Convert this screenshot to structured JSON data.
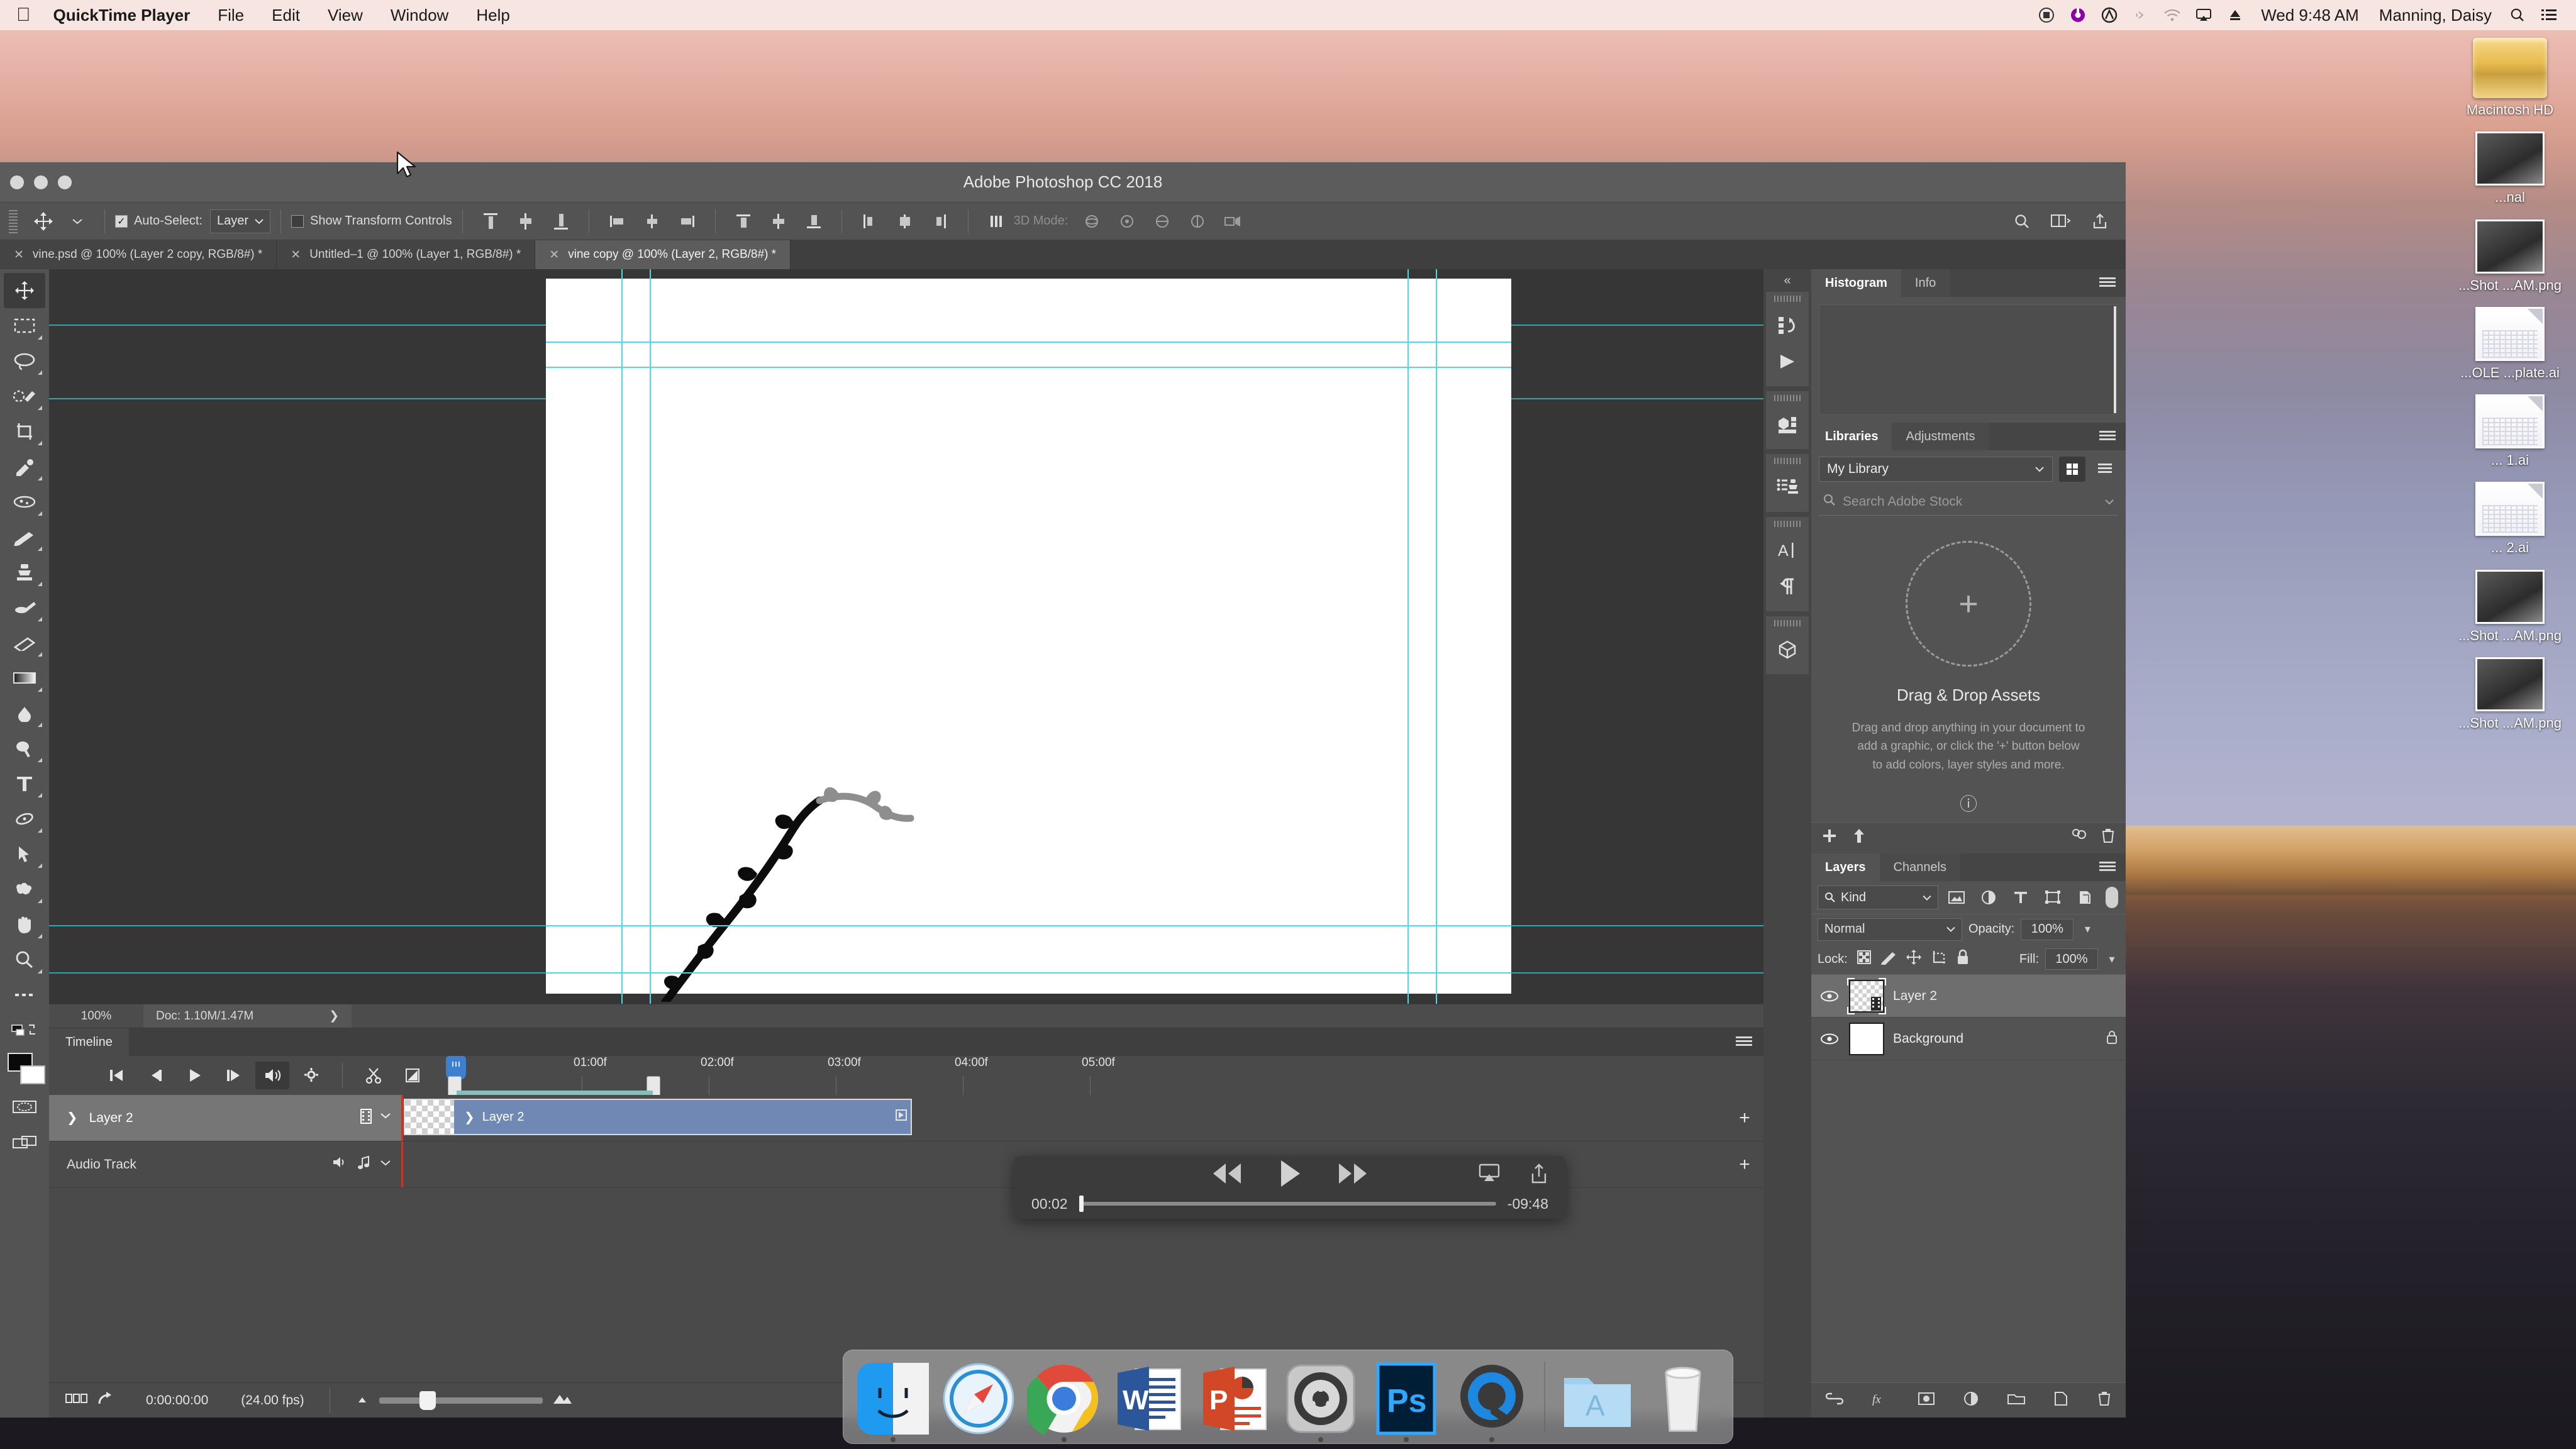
{
  "menubar": {
    "apple_icon": "apple-logo",
    "app_name": "QuickTime Player",
    "items": [
      "File",
      "Edit",
      "View",
      "Window",
      "Help"
    ],
    "status_icons": [
      "record-icon",
      "creative-cloud-icon",
      "adobe-icon",
      "bluetooth-icon",
      "wifi-icon",
      "airplay-icon",
      "eject-icon"
    ],
    "clock": "Wed 9:48 AM",
    "user": "Manning, Daisy",
    "search_icon": "search-icon",
    "control_center_icon": "list-icon"
  },
  "desktop": {
    "files": [
      {
        "label": "Macintosh HD",
        "kind": "hard-drive"
      },
      {
        "label": "...nal",
        "kind": "photo"
      },
      {
        "label": "...Shot\n...AM.png",
        "kind": "photo"
      },
      {
        "label": "...OLE\n...plate.ai",
        "kind": "ai"
      },
      {
        "label": "... 1.ai",
        "kind": "ai"
      },
      {
        "label": "... 2.ai",
        "kind": "ai"
      },
      {
        "label": "...Shot\n...AM.png",
        "kind": "photo"
      },
      {
        "label": "...Shot\n...AM.png",
        "kind": "photo"
      }
    ]
  },
  "photoshop": {
    "window_title": "Adobe Photoshop CC 2018",
    "options_bar": {
      "move_tool_icon": "move-tool-icon",
      "auto_select_label": "Auto-Select:",
      "auto_select_checked": true,
      "auto_select_value": "Layer",
      "show_transform_label": "Show Transform Controls",
      "show_transform_checked": false,
      "align_icons": [
        "align-top-edges-icon",
        "align-vertical-centers-icon",
        "align-bottom-edges-icon",
        "align-left-edges-icon",
        "align-horizontal-centers-icon",
        "align-right-edges-icon",
        "distribute-top-icon",
        "distribute-vertical-center-icon",
        "distribute-bottom-icon",
        "distribute-left-icon",
        "distribute-horizontal-center-icon",
        "distribute-right-icon",
        "distribute-spacing-icon"
      ],
      "mode_3d_label": "3D Mode:",
      "mode_3d_icons": [
        "orbit-3d-icon",
        "roll-3d-icon",
        "pan-3d-icon",
        "slide-3d-icon",
        "scale-3d-icon"
      ],
      "right_icons": [
        "search-icon",
        "workspace-icon",
        "share-icon"
      ]
    },
    "tabs": [
      {
        "title": "vine.psd @ 100% (Layer 2 copy, RGB/8#) *",
        "active": false
      },
      {
        "title": "Untitled–1 @ 100% (Layer 1, RGB/8#) *",
        "active": false
      },
      {
        "title": "vine copy @ 100% (Layer 2, RGB/8#) *",
        "active": true
      }
    ],
    "toolbox": [
      "move-tool-icon",
      "rectangular-marquee-icon",
      "lasso-icon",
      "quick-selection-icon",
      "crop-icon",
      "eyedropper-icon",
      "spot-healing-brush-icon",
      "brush-icon",
      "clone-stamp-icon",
      "history-brush-icon",
      "eraser-icon",
      "gradient-icon",
      "blur-icon",
      "dodge-icon",
      "type-tool-icon",
      "pen-tool-icon",
      "path-selection-icon",
      "custom-shape-icon",
      "hand-tool-icon",
      "zoom-tool-icon",
      "edit-toolbar-icon",
      "quick-mask-icon",
      "screen-mode-icon"
    ],
    "status_bar": {
      "zoom": "100%",
      "doc_label": "Doc: 1.10M/1.47M",
      "expand_icon": "chevron-right-icon"
    },
    "timeline": {
      "panel_title": "Timeline",
      "transport_icons": [
        "go-to-first-frame-icon",
        "previous-frame-icon",
        "play-icon",
        "next-frame-icon",
        "audio-icon",
        "settings-gear-icon"
      ],
      "edit_icons": [
        "split-at-playhead-icon",
        "transition-icon"
      ],
      "ruler_ticks": [
        "01:00f",
        "02:00f",
        "03:00f",
        "04:00f",
        "05:00f"
      ],
      "tracks": [
        {
          "name": "Layer 2",
          "type": "video",
          "clip_label": "Layer 2",
          "icons": [
            "filmstrip-icon",
            "chevron-down-icon"
          ]
        },
        {
          "name": "Audio Track",
          "type": "audio",
          "icons": [
            "speaker-icon",
            "music-note-icon",
            "chevron-down-icon"
          ]
        }
      ],
      "add_track_icon": "plus-icon",
      "footer": {
        "onion_skin_icon": "onion-skin-icon",
        "render_icon": "render-video-icon",
        "timecode": "0:00:00:00",
        "framerate": "(24.00 fps)",
        "zoom_out_icon": "small-mountain-icon",
        "zoom_in_icon": "large-mountain-icon"
      }
    },
    "right_rail": {
      "collapse_icon": "collapse-panels-icon",
      "groups": [
        [
          "history-icon",
          "actions-play-icon"
        ],
        [
          "properties-icon"
        ],
        [
          "styles-stamp-icon"
        ],
        [
          "character-icon",
          "paragraph-icon"
        ],
        [
          "3d-cube-icon"
        ]
      ]
    },
    "histogram_panel": {
      "tabs": [
        "Histogram",
        "Info"
      ],
      "active_tab": "Histogram",
      "menu_icon": "panel-menu-icon"
    },
    "libraries_panel": {
      "tabs": [
        "Libraries",
        "Adjustments"
      ],
      "active_tab": "Libraries",
      "menu_icon": "panel-menu-icon",
      "library_select": "My Library",
      "view_grid_icon": "grid-view-icon",
      "view_list_icon": "list-view-icon",
      "search_placeholder": "Search Adobe Stock",
      "search_icon": "search-icon",
      "empty_title": "Drag & Drop Assets",
      "empty_desc": "Drag and drop anything in your document to add a graphic, or click the '+' button below to add colors, layer styles and more.",
      "help_icon": "help-circle-icon",
      "footer_icons": [
        "add-plus-icon",
        "upload-icon",
        "collaborate-icon",
        "delete-trash-icon"
      ]
    },
    "layers_panel": {
      "tabs": [
        "Layers",
        "Channels"
      ],
      "active_tab": "Layers",
      "menu_icon": "panel-menu-icon",
      "filter_kind": "Kind",
      "filter_icons": [
        "filter-pixel-icon",
        "filter-adjustment-icon",
        "filter-type-icon",
        "filter-shape-icon",
        "filter-smart-object-icon"
      ],
      "filter_toggle": "filter-enable-toggle",
      "blend_mode": "Normal",
      "opacity_label": "Opacity:",
      "opacity_value": "100%",
      "lock_label": "Lock:",
      "lock_icons": [
        "lock-transparent-pixels-icon",
        "lock-image-pixels-icon",
        "lock-position-icon",
        "lock-artboard-icon",
        "lock-all-icon"
      ],
      "fill_label": "Fill:",
      "fill_value": "100%",
      "layers": [
        {
          "name": "Layer 2",
          "visible": true,
          "selected": true,
          "thumb": "checker-video",
          "locked": false
        },
        {
          "name": "Background",
          "visible": true,
          "selected": false,
          "thumb": "white",
          "locked": true
        }
      ],
      "footer_icons": [
        "link-layers-icon",
        "layer-style-fx-icon",
        "add-mask-icon",
        "adjustment-layer-icon",
        "new-group-icon",
        "new-layer-icon",
        "delete-layer-icon"
      ]
    },
    "canvas": {
      "artwork": "vine-drawing",
      "guides_color": "#4fd8e8"
    }
  },
  "quicktime_controls": {
    "rewind_icon": "rewind-icon",
    "play_icon": "play-icon",
    "fast_forward_icon": "fast-forward-icon",
    "airplay_icon": "airplay-icon",
    "share_icon": "share-icon",
    "current_time": "00:02",
    "remaining_time": "-09:48",
    "progress_percent": 0.4
  },
  "dock": {
    "items": [
      {
        "name": "Finder",
        "icon": "finder-icon",
        "running": true
      },
      {
        "name": "Safari",
        "icon": "safari-icon",
        "running": false
      },
      {
        "name": "Google Chrome",
        "icon": "chrome-icon",
        "running": true
      },
      {
        "name": "Microsoft Word",
        "icon": "word-icon",
        "running": false
      },
      {
        "name": "Microsoft PowerPoint",
        "icon": "powerpoint-icon",
        "running": false
      },
      {
        "name": "System Preferences",
        "icon": "system-preferences-icon",
        "running": true
      },
      {
        "name": "Adobe Photoshop",
        "icon": "photoshop-icon",
        "running": true
      },
      {
        "name": "QuickTime Player",
        "icon": "quicktime-icon",
        "running": true
      },
      {
        "name": "Applications",
        "icon": "applications-folder-icon",
        "running": false
      },
      {
        "name": "Trash",
        "icon": "trash-icon",
        "running": false
      }
    ]
  },
  "cursor": {
    "icon": "arrow-cursor-icon"
  }
}
